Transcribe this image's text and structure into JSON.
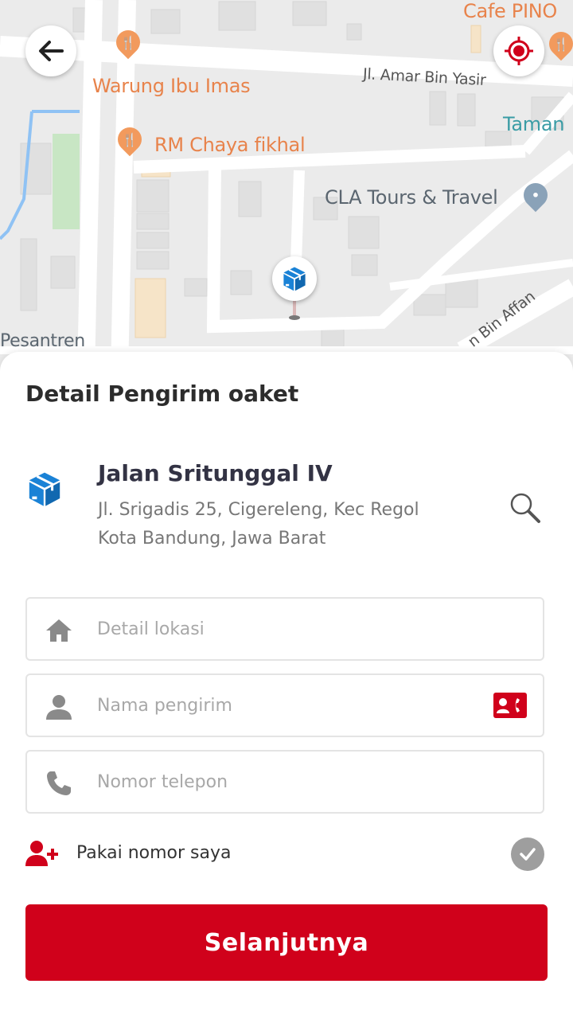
{
  "map": {
    "labels": {
      "cafe": "Cafe PINO",
      "warung": "Warung Ibu Imas",
      "street_amar": "Jl. Amar Bin Yasir",
      "taman": "Taman",
      "rm_chaya": "RM Chaya fikhal",
      "cla_tours": "CLA Tours & Travel",
      "pesantren": "Pesantren",
      "street_affan": "n Bin Affan"
    },
    "icons": {
      "back": "arrow-left-icon",
      "locate": "crosshair-target-icon",
      "marker": "package-box-icon",
      "restaurant": "fork-knife-icon",
      "place": "map-pin-icon"
    }
  },
  "sheet": {
    "title": "Detail Pengirim oaket",
    "address": {
      "name": "Jalan Sritunggal IV",
      "line1": "Jl. Srigadis 25, Cigereleng, Kec Regol",
      "line2": "Kota Bandung, Jawa Barat"
    },
    "fields": {
      "lokasi_placeholder": "Detail lokasi",
      "nama_placeholder": "Nama pengirim",
      "telepon_placeholder": "Nomor telepon"
    },
    "use_my_number_label": "Pakai nomor saya",
    "next_label": "Selanjutnya"
  },
  "colors": {
    "primary": "#d0011b",
    "package_blue": "#1a82d6",
    "poi_orange": "#e8834b",
    "poi_teal": "#3a9ca5",
    "icon_gray": "#9e9e9e"
  }
}
